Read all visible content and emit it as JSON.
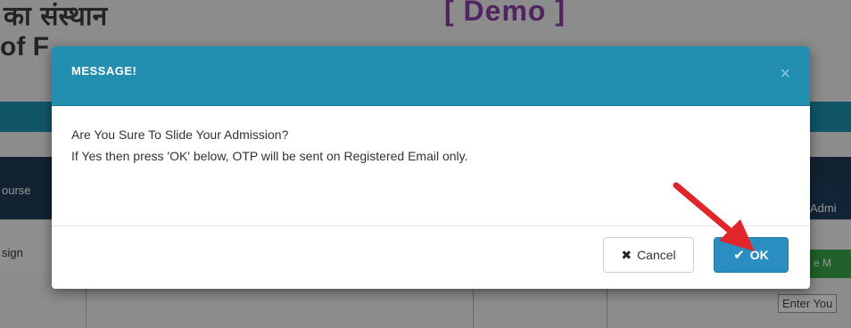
{
  "background": {
    "hindi_heading": "का संस्थान",
    "english_heading_fragment": "of F",
    "demo_label": "[ Demo ]",
    "left_cell_course": "ourse",
    "left_cell_sign": "sign",
    "right_cell_admi": "Admi",
    "right_green_btn": "e M",
    "right_enter": "Enter You"
  },
  "modal": {
    "title": "MESSAGE!",
    "close_symbol": "×",
    "line1": "Are You Sure To Slide Your Admission?",
    "line2": "If Yes then press 'OK' below, OTP will be sent on Registered Email only.",
    "cancel_label": "Cancel",
    "ok_label": "OK",
    "cancel_icon": "close-x-icon",
    "ok_icon": "check-icon"
  },
  "annotation": {
    "arrow_color": "#e0262a"
  },
  "colors": {
    "header": "#238fb0",
    "ok_button": "#2a8fc0"
  }
}
